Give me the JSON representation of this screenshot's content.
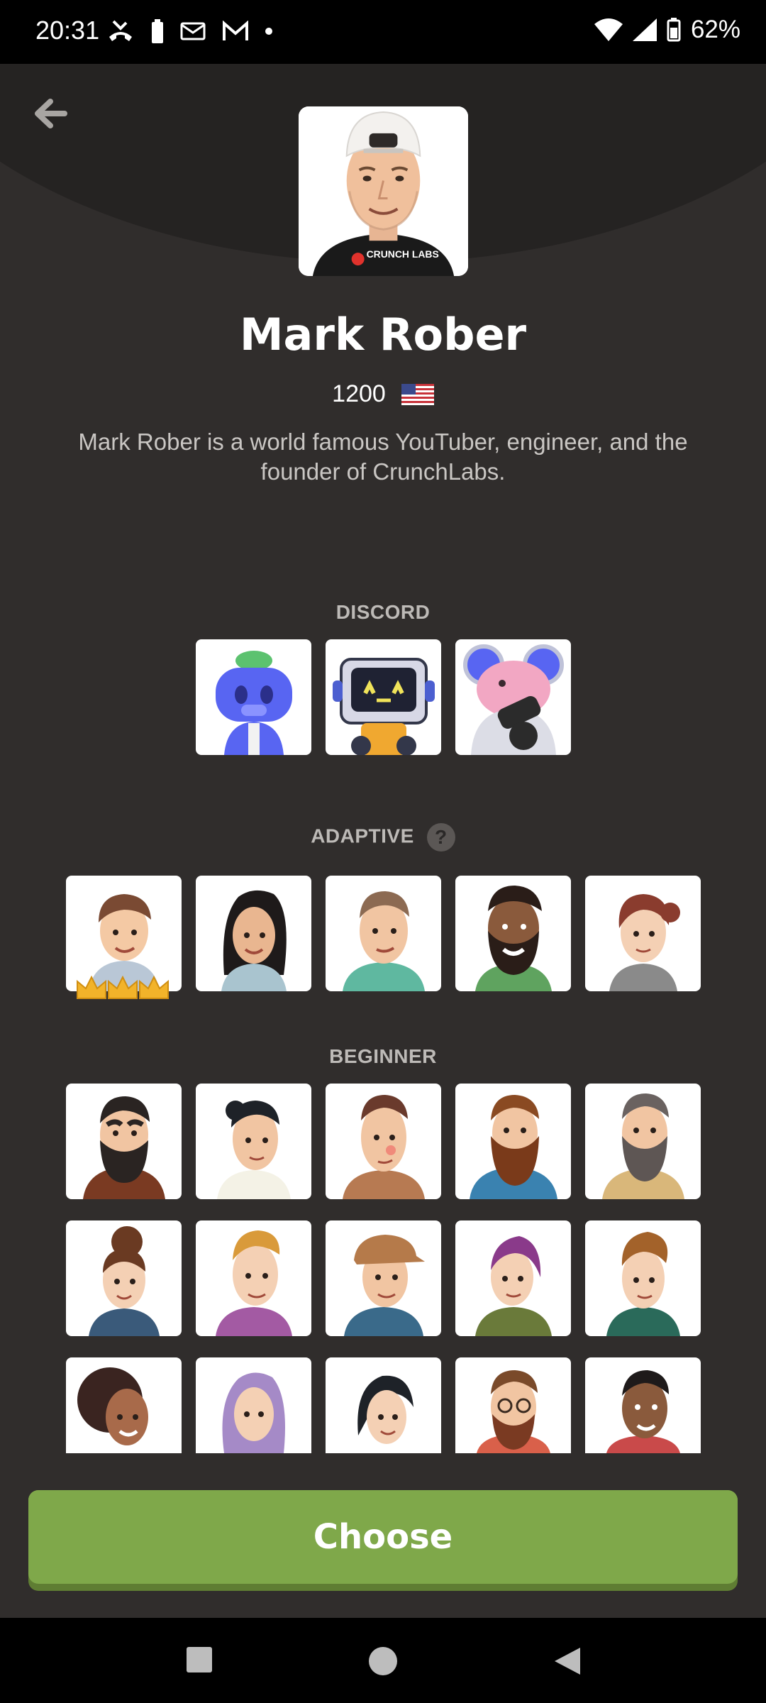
{
  "status_bar": {
    "time": "20:31",
    "battery": "62%",
    "left_icons": [
      "missed-call-icon",
      "battery-icon",
      "mail-icon",
      "gmail-icon",
      "dot-icon"
    ],
    "right_icons": [
      "wifi-icon",
      "signal-icon",
      "battery-icon"
    ]
  },
  "profile": {
    "name": "Mark Rober",
    "rating": "1200",
    "country_flag": "us-flag-icon",
    "description": "Mark Rober is a world famous YouTuber, engineer, and the founder of CrunchLabs.",
    "shirt_text": "CRUNCH LABS"
  },
  "sections": {
    "discord": {
      "title": "DISCORD"
    },
    "adaptive": {
      "title": "ADAPTIVE",
      "help": "?"
    },
    "beginner": {
      "title": "BEGINNER"
    }
  },
  "choose_button": {
    "label": "Choose"
  },
  "colors": {
    "background": "#302d2c",
    "header": "#252322",
    "accent": "#7fa84a",
    "crown": "#f2b32a"
  }
}
